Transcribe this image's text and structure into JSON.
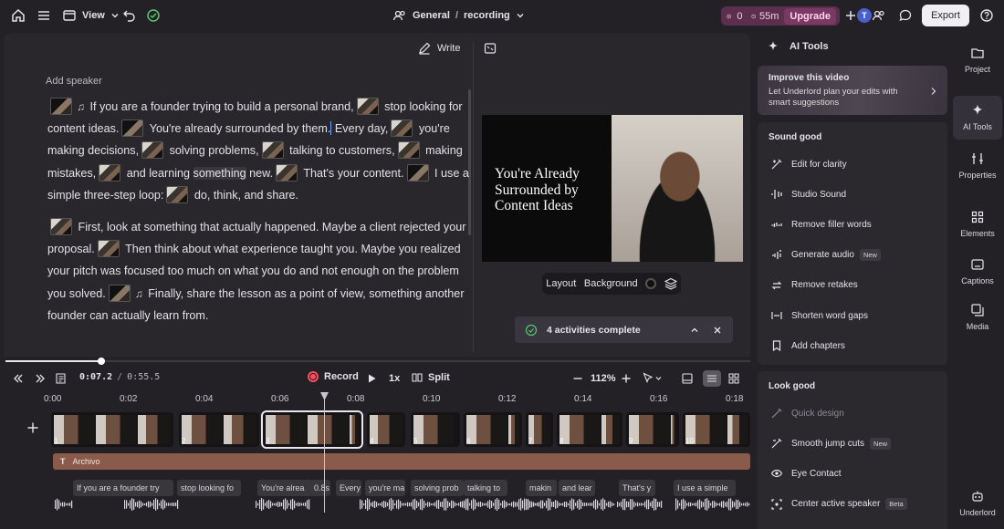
{
  "topbar": {
    "view_label": "View",
    "breadcrumb_space": "General",
    "breadcrumb_sep": "/",
    "breadcrumb_project": "recording",
    "credits_count": "0",
    "credits_time": "55m",
    "upgrade_label": "Upgrade",
    "avatar_letter": "T",
    "export_label": "Export"
  },
  "editor": {
    "write_label": "Write",
    "add_speaker": "Add speaker",
    "transcript": {
      "p1": [
        "If you are a founder trying to build a personal brand,",
        "stop looking for content ideas.",
        "You're already surrounded by them.",
        "Every day,",
        "you're making decisions,",
        "solving problems,",
        "talking to customers,",
        "making mistakes,",
        "and learning",
        "something",
        "new.",
        "That's your content.",
        "I use a simple three-step loop:",
        "do, think, and share."
      ],
      "p2": [
        "First, look at something that actually happened. Maybe a client rejected your proposal.",
        "Then think about what experience taught you. Maybe you realized your pitch was focused too much on what you do and not enough on the problem you solved.",
        "Finally, share the lesson as a point of view, something another founder can actually learn from."
      ]
    }
  },
  "preview": {
    "overlay_title": "You're Already Surrounded by Content Ideas",
    "layout_label": "Layout",
    "background_label": "Background",
    "activities_label": "4 activities complete"
  },
  "timeline": {
    "record_label": "Record",
    "speed_label": "1x",
    "split_label": "Split",
    "time_current": "0:07.2",
    "time_sep": "/",
    "time_total": "0:55.5",
    "zoom_label": "112%",
    "ruler_ticks": [
      "0:00",
      "0:02",
      "0:04",
      "0:06",
      "0:08",
      "0:10",
      "0:12",
      "0:14",
      "0:16",
      "0:18"
    ],
    "clip_numbers": [
      "1",
      "2",
      "3",
      "4",
      "5",
      "6",
      "7",
      "8",
      "9",
      "10"
    ],
    "archivo_label": "Archivo",
    "words": [
      "If you are a founder try",
      "stop looking fo",
      "You're alrea",
      "0.8s",
      "Every",
      "you're ma",
      "solving prob",
      "talking to",
      "makin",
      "and lear",
      "That's y",
      "I use a simple"
    ]
  },
  "ai_tools": {
    "title": "AI Tools",
    "improve_title": "Improve this video",
    "improve_text": "Let Underlord plan your edits with smart suggestions",
    "sound_heading": "Sound good",
    "sound_items": [
      {
        "label": "Edit for clarity",
        "badge": ""
      },
      {
        "label": "Studio Sound",
        "badge": ""
      },
      {
        "label": "Remove filler words",
        "badge": ""
      },
      {
        "label": "Generate audio",
        "badge": "New"
      },
      {
        "label": "Remove retakes",
        "badge": ""
      },
      {
        "label": "Shorten word gaps",
        "badge": ""
      },
      {
        "label": "Add chapters",
        "badge": ""
      }
    ],
    "look_heading": "Look good",
    "look_items": [
      {
        "label": "Quick design",
        "badge": ""
      },
      {
        "label": "Smooth jump cuts",
        "badge": "New"
      },
      {
        "label": "Eye Contact",
        "badge": ""
      },
      {
        "label": "Center active speaker",
        "badge": "Beta"
      }
    ]
  },
  "sidenav": [
    "Project",
    "AI Tools",
    "Properties",
    "Elements",
    "Captions",
    "Media",
    "Underlord"
  ],
  "colors": {
    "accent": "#7a3863",
    "record": "#ff4d5e",
    "waveform": "#d8d4dc"
  }
}
